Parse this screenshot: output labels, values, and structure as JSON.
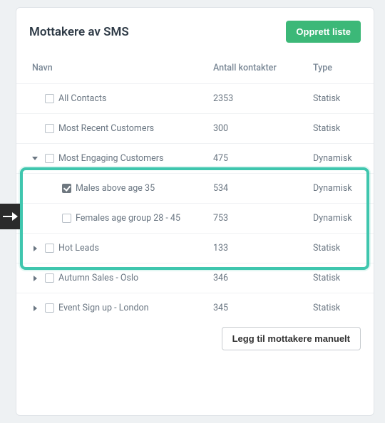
{
  "panel": {
    "title": "Mottakere av SMS",
    "create_list_btn": "Opprett liste",
    "add_manual_btn": "Legg til mottakere manuelt"
  },
  "columns": {
    "name": "Navn",
    "count": "Antall kontakter",
    "type": "Type"
  },
  "rows": [
    {
      "expand": "",
      "checked": false,
      "name": "All Contacts",
      "count": "2353",
      "type": "Statisk",
      "child": false
    },
    {
      "expand": "",
      "checked": false,
      "name": "Most Recent Customers",
      "count": "300",
      "type": "Statisk",
      "child": false
    },
    {
      "expand": "down",
      "checked": false,
      "name": "Most Engaging Customers",
      "count": "475",
      "type": "Dynamisk",
      "child": false
    },
    {
      "expand": "",
      "checked": true,
      "name": "Males above age 35",
      "count": "534",
      "type": "Dynamisk",
      "child": true
    },
    {
      "expand": "",
      "checked": false,
      "name": "Females age group 28 - 45",
      "count": "753",
      "type": "Dynamisk",
      "child": true
    },
    {
      "expand": "right",
      "checked": false,
      "name": "Hot Leads",
      "count": "133",
      "type": "Statisk",
      "child": false
    },
    {
      "expand": "right",
      "checked": false,
      "name": "Autumn Sales - Oslo",
      "count": "346",
      "type": "Statisk",
      "child": false
    },
    {
      "expand": "right",
      "checked": false,
      "name": "Event Sign up - London",
      "count": "345",
      "type": "Statisk",
      "child": false
    }
  ]
}
